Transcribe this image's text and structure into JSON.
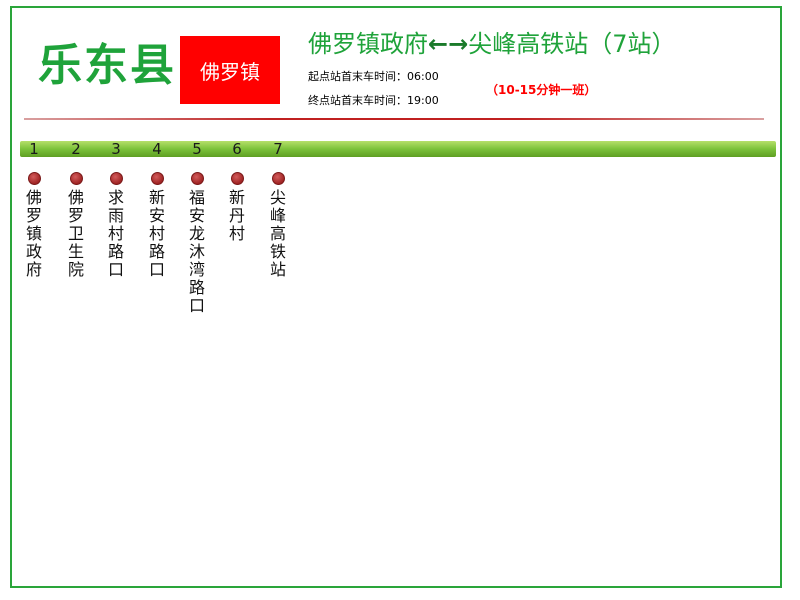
{
  "header": {
    "county": "乐东县",
    "town": "佛罗镇",
    "route_from": "佛罗镇政府",
    "route_arrow": "←→",
    "route_to": "尖峰高铁站",
    "route_count": "（7站）",
    "origin_times": "起点站首末车时间：06:00",
    "terminal_times": "终点站首末车时间：19:00",
    "frequency": "（10-15分钟一班）"
  },
  "stops": [
    {
      "num": "1",
      "name": "佛罗镇政府"
    },
    {
      "num": "2",
      "name": "佛罗卫生院"
    },
    {
      "num": "3",
      "name": "求雨村路口"
    },
    {
      "num": "4",
      "name": "新安村路口"
    },
    {
      "num": "5",
      "name": "福安龙沐湾路口"
    },
    {
      "num": "6",
      "name": "新丹村"
    },
    {
      "num": "7",
      "name": "尖峰高铁站"
    }
  ],
  "colors": {
    "title_green": "#1fa33a",
    "town_red": "#ff0000",
    "stop_dot": "#a02424",
    "bar_green": "#7cc23a"
  }
}
